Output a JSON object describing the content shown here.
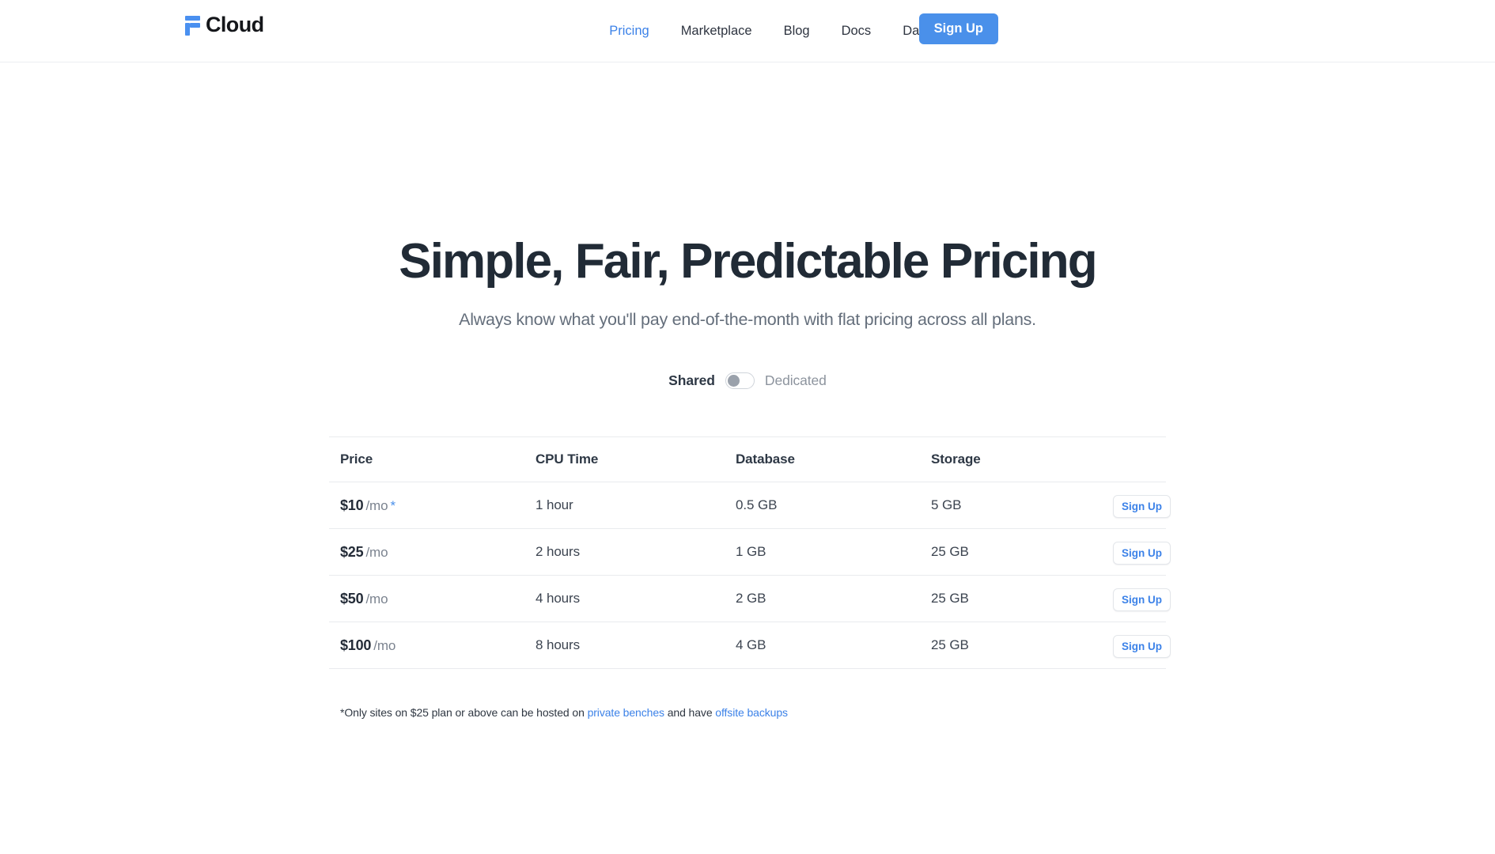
{
  "header": {
    "brand": {
      "mark_icon": "f-logo-icon",
      "name": "Cloud"
    },
    "nav_items": [
      {
        "label": "Pricing",
        "active": true
      },
      {
        "label": "Marketplace",
        "active": false
      },
      {
        "label": "Blog",
        "active": false
      },
      {
        "label": "Docs",
        "active": false
      },
      {
        "label": "Dashboard →",
        "active": false
      }
    ],
    "cta_label": "Sign Up"
  },
  "hero": {
    "title": "Simple, Fair, Predictable Pricing",
    "subtitle": "Always know what you'll pay end-of-the-month with flat pricing across all plans."
  },
  "plan_toggle": {
    "left_label": "Shared",
    "right_label": "Dedicated",
    "selected": "Shared",
    "knob_position": "left"
  },
  "pricing_table": {
    "columns": [
      "Price",
      "CPU Time",
      "Database",
      "Storage",
      ""
    ],
    "rows": [
      {
        "price_amount": "$10",
        "price_period": "/mo",
        "asterisk": "*",
        "cpu_time": "1 hour",
        "database": "0.5 GB",
        "storage": "5 GB",
        "action_label": "Sign Up"
      },
      {
        "price_amount": "$25",
        "price_period": "/mo",
        "asterisk": "",
        "cpu_time": "2 hours",
        "database": "1 GB",
        "storage": "25 GB",
        "action_label": "Sign Up"
      },
      {
        "price_amount": "$50",
        "price_period": "/mo",
        "asterisk": "",
        "cpu_time": "4 hours",
        "database": "2 GB",
        "storage": "25 GB",
        "action_label": "Sign Up"
      },
      {
        "price_amount": "$100",
        "price_period": "/mo",
        "asterisk": "",
        "cpu_time": "8 hours",
        "database": "4 GB",
        "storage": "25 GB",
        "action_label": "Sign Up"
      }
    ]
  },
  "footnote": {
    "part1": "*Only sites on $25 plan or above can be hosted on ",
    "link1": "private benches",
    "part2": " and have ",
    "link2": "offsite backups"
  },
  "colors": {
    "accent_blue": "#4a90ea",
    "link_blue": "#3c82e8",
    "heading": "#212b36",
    "muted_text": "#646e7b",
    "border": "#e9ebee"
  }
}
